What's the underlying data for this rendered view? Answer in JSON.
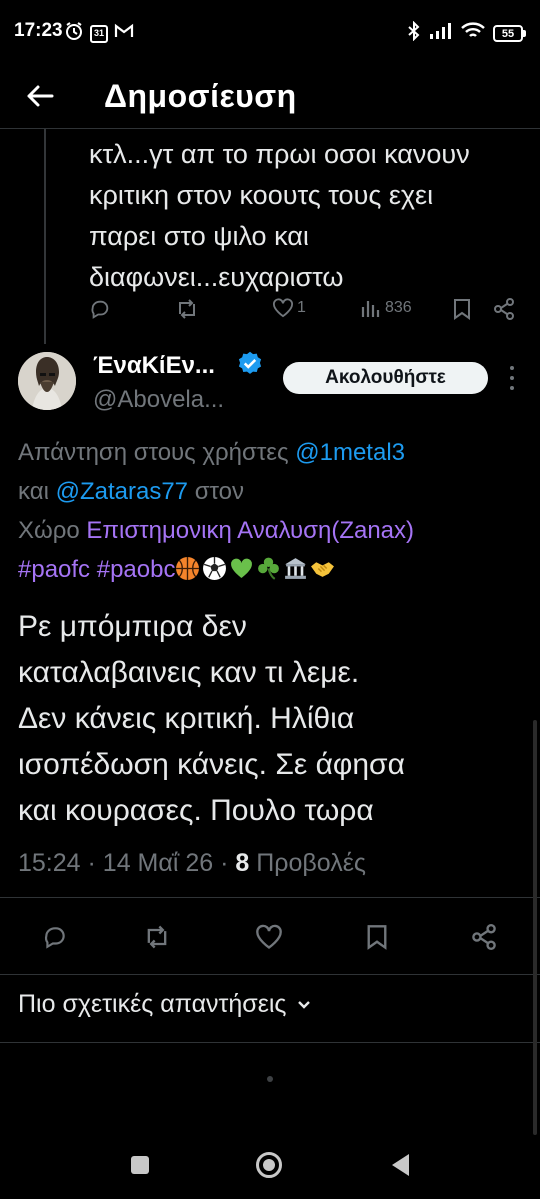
{
  "status_bar": {
    "time": "17:23",
    "calendar_day": "31",
    "battery": "55",
    "icons": [
      "alarm-icon",
      "calendar-icon",
      "gmail-icon",
      "bluetooth-icon",
      "signal-icon",
      "wifi-icon",
      "battery-icon"
    ]
  },
  "header": {
    "title": "Δημοσίευση",
    "back_icon": "arrow-left-icon"
  },
  "previous_post": {
    "lines": [
      "κτλ...γτ απ το πρωι οσοι κανουν",
      "κριτικη στον κοουτς τους εχει",
      "παρει στο ψιλο και",
      "διαφωνει...ευχαριστω"
    ],
    "likes": "1",
    "views": "836"
  },
  "post": {
    "author_name": "ΈναΚίΕν...",
    "author_handle": "@Abovela...",
    "follow_label": "Ακολουθήστε",
    "reply_prefix": "Απάντηση στους χρήστες",
    "reply_user1": "@1metal3",
    "reply_and": "και",
    "reply_user2": "@Zataras77",
    "reply_in": "στον",
    "reply_space_word": "Χώρο",
    "space_name": "Επιστημονικη Αναλυση(Zanax)",
    "hashtag1": "#paofc",
    "hashtag2": "#paobc",
    "body_lines": [
      "Ρε μπόμπιρα δεν",
      "καταλαβαινεις καν τι λεμε.",
      "Δεν κάνεις κριτική. Ηλίθια",
      "ισοπέδωση κάνεις. Σε άφησα",
      "και κουρασες. Πουλο τωρα"
    ],
    "time": "15:24",
    "date": "14 Μαΐ 26",
    "views_count": "8",
    "views_label": "Προβολές"
  },
  "relevant_replies": {
    "label": "Πιο σχετικές απαντήσεις"
  },
  "colors": {
    "background": "#000000",
    "text": "#e7e9ea",
    "muted": "#71767b",
    "link": "#1d9bf0",
    "space_purple": "#a574f5",
    "verified": "#1d9bf0"
  }
}
